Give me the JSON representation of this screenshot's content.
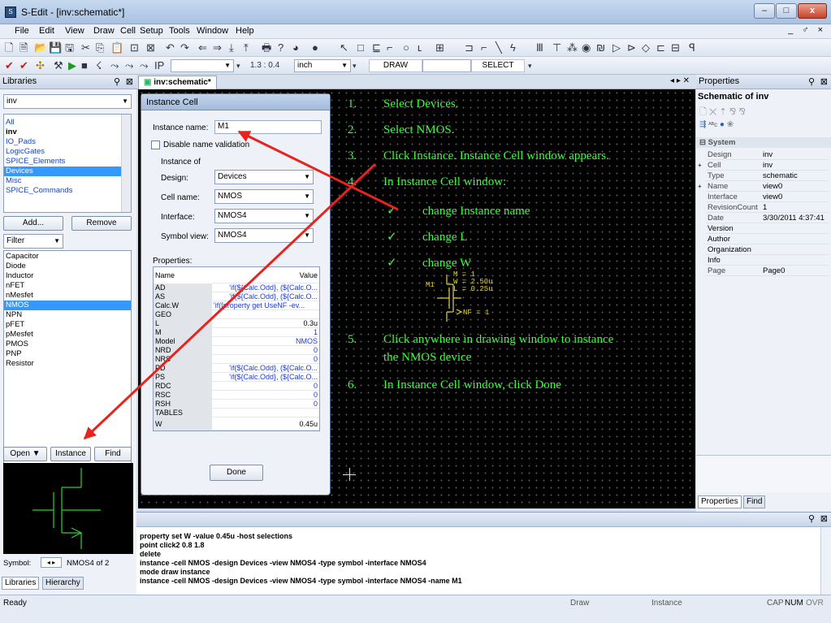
{
  "window": {
    "title": "S-Edit - [inv:schematic*]",
    "min": "–",
    "max": "□",
    "close": "x"
  },
  "menu": {
    "items": [
      "File",
      "Edit",
      "View",
      "Draw",
      "Cell",
      "Setup",
      "Tools",
      "Window",
      "Help"
    ],
    "mdi_controls": "_ ♂ ×"
  },
  "toolbar2": {
    "zoom_ratio": "1.3 : 0.4",
    "unit": "inch",
    "mode_label": "DRAW",
    "select_label": "SELECT"
  },
  "libraries_panel": {
    "title": "Libraries",
    "library_combo": "inv",
    "libraries": [
      "All",
      "inv",
      "IO_Pads",
      "LogicGates",
      "SPICE_Elements",
      "Devices",
      "Misc",
      "SPICE_Commands"
    ],
    "selected_library": "Devices",
    "add_label": "Add...",
    "remove_label": "Remove",
    "filter_label": "Filter",
    "cells": [
      "Capacitor",
      "Diode",
      "Inductor",
      "nFET",
      "nMesfet",
      "NMOS",
      "NPN",
      "pFET",
      "pMesfet",
      "PMOS",
      "PNP",
      "Resistor"
    ],
    "selected_cell": "NMOS",
    "open_label": "Open",
    "instance_label": "Instance",
    "find_label": "Find",
    "symbol_label": "Symbol:",
    "symbol_value": "NMOS4 of 2",
    "tab_libraries": "Libraries",
    "tab_hierarchy": "Hierarchy"
  },
  "document_tab": {
    "label": "inv:schematic*"
  },
  "instance_dialog": {
    "title": "Instance Cell",
    "instance_name_label": "Instance name:",
    "instance_name": "M1",
    "disable_validation_label": "Disable name validation",
    "instance_of_label": "Instance of",
    "design_label": "Design:",
    "design_value": "Devices",
    "cell_name_label": "Cell name:",
    "cell_name_value": "NMOS",
    "interface_label": "Interface:",
    "interface_value": "NMOS4",
    "symbol_view_label": "Symbol view:",
    "symbol_view_value": "NMOS4",
    "properties_label": "Properties:",
    "col_name": "Name",
    "col_value": "Value",
    "properties": [
      {
        "name": "AD",
        "value": "'if(${Calc.Odd}, (${Calc.O..."
      },
      {
        "name": "AS",
        "value": "'if(${Calc.Odd}, (${Calc.O..."
      },
      {
        "name": "Calc.W",
        "value": "'if([property get UseNF -ev..."
      },
      {
        "name": "GEO",
        "value": ""
      },
      {
        "name": "L",
        "value": "0.3u"
      },
      {
        "name": "M",
        "value": "1"
      },
      {
        "name": "Model",
        "value": "NMOS"
      },
      {
        "name": "NRD",
        "value": "0"
      },
      {
        "name": "NRS",
        "value": "0"
      },
      {
        "name": "PD",
        "value": "'if(${Calc.Odd}, (${Calc.O..."
      },
      {
        "name": "PS",
        "value": "'if(${Calc.Odd}, (${Calc.O..."
      },
      {
        "name": "RDC",
        "value": "0"
      },
      {
        "name": "RSC",
        "value": "0"
      },
      {
        "name": "RSH",
        "value": "0"
      },
      {
        "name": "TABLES",
        "value": ""
      },
      {
        "name": "W",
        "value": "0.45u"
      }
    ],
    "done_label": "Done"
  },
  "instructions": [
    {
      "num": "1.",
      "text": "Select Devices."
    },
    {
      "num": "2.",
      "text": "Select NMOS."
    },
    {
      "num": "3.",
      "text": "Click Instance. Instance Cell window appears."
    },
    {
      "num": "4.",
      "text": "In Instance Cell window:"
    },
    {
      "num": "✓",
      "text": "change Instance name"
    },
    {
      "num": "✓",
      "text": "change L"
    },
    {
      "num": "✓",
      "text": "change W"
    },
    {
      "num": "5.",
      "text": "Click anywhere in drawing window to instance"
    },
    {
      "num": "",
      "text": "the NMOS device"
    },
    {
      "num": "6.",
      "text": "In Instance Cell window, click Done"
    }
  ],
  "nmos_symbol": {
    "name": "M1",
    "m": "M = 1",
    "w": "W = 2.50u",
    "l": "L = 0.25u",
    "nf": "NF = 1"
  },
  "properties_panel": {
    "title": "Properties",
    "subtitle": "Schematic of inv",
    "section": "System",
    "rows": [
      {
        "key": "Design",
        "value": "inv",
        "expand": ""
      },
      {
        "key": "Cell",
        "value": "inv",
        "expand": "+"
      },
      {
        "key": "Type",
        "value": "schematic",
        "expand": ""
      },
      {
        "key": "Name",
        "value": "view0",
        "expand": "+"
      },
      {
        "key": "Interface",
        "value": "view0",
        "expand": ""
      },
      {
        "key": "RevisionCount",
        "value": "1",
        "expand": ""
      },
      {
        "key": "Date",
        "value": "3/30/2011 4:37:41",
        "expand": ""
      },
      {
        "key": "Version",
        "value": "",
        "expand": ""
      },
      {
        "key": "Author",
        "value": "",
        "expand": ""
      },
      {
        "key": "Organization",
        "value": "",
        "expand": ""
      },
      {
        "key": "Info",
        "value": "",
        "expand": ""
      },
      {
        "key": "Page",
        "value": "Page0",
        "expand": ""
      }
    ],
    "tab_properties": "Properties",
    "tab_find": "Find"
  },
  "command_log": [
    "property set W -value 0.45u -host selections",
    "point click2 0.8 1.8",
    "delete",
    "instance -cell NMOS -design Devices -view NMOS4 -type symbol -interface NMOS4",
    "mode draw instance",
    "instance -cell NMOS -design Devices -view NMOS4 -type symbol -interface NMOS4 -name M1"
  ],
  "status": {
    "ready": "Ready",
    "draw": "Draw",
    "instance": "Instance",
    "cap": "CAP",
    "num": "NUM",
    "ovr": "OVR"
  },
  "colors": {
    "instruction_text": "#39ff39",
    "arrow": "#e8221c",
    "selection": "#3399ff"
  }
}
